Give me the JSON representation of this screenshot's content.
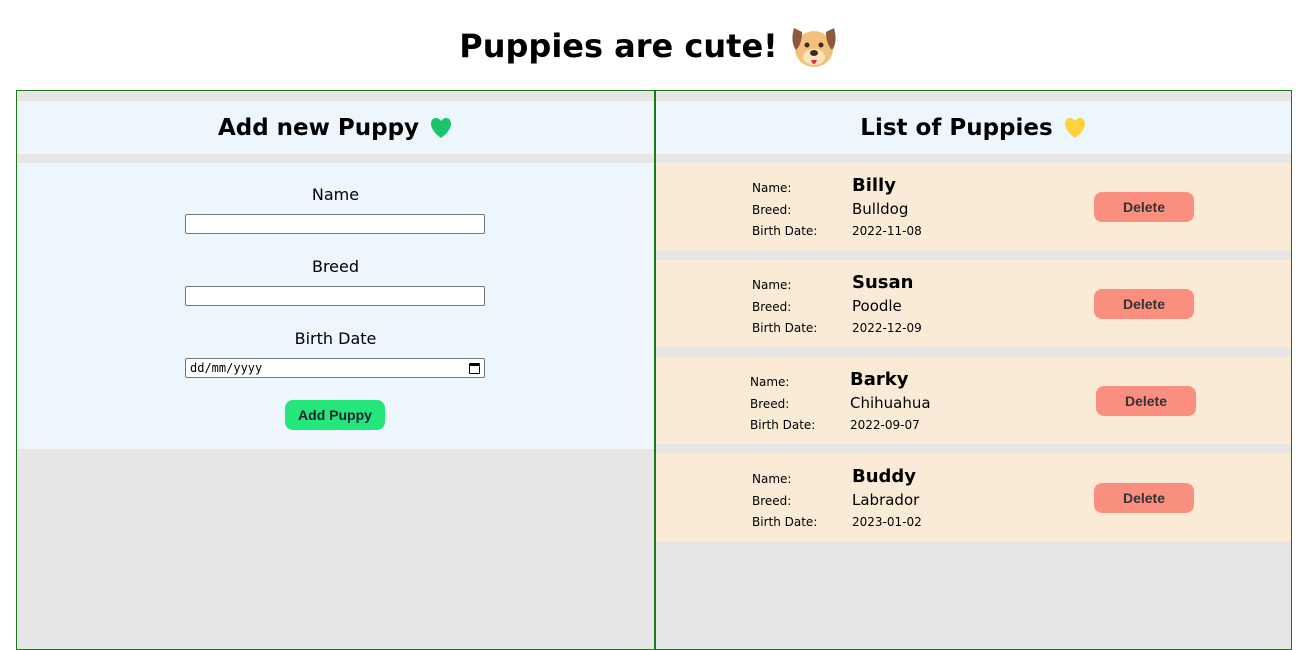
{
  "page_title": "Puppies are cute!",
  "form": {
    "heading": "Add new Puppy",
    "name_label": "Name",
    "name_value": "",
    "breed_label": "Breed",
    "breed_value": "",
    "birth_date_label": "Birth Date",
    "birth_date_placeholder": "dd/mm/yyyy",
    "submit_label": "Add Puppy"
  },
  "list": {
    "heading": "List of Puppies",
    "name_key": "Name:",
    "breed_key": "Breed:",
    "birth_key": "Birth Date:",
    "delete_label": "Delete",
    "puppies": [
      {
        "name": "Billy",
        "breed": "Bulldog",
        "birth_date": "2022-11-08"
      },
      {
        "name": "Susan",
        "breed": "Poodle",
        "birth_date": "2022-12-09"
      },
      {
        "name": "Barky",
        "breed": "Chihuahua",
        "birth_date": "2022-09-07"
      },
      {
        "name": "Buddy",
        "breed": "Labrador",
        "birth_date": "2023-01-02"
      }
    ]
  },
  "colors": {
    "border": "#1a7a1a",
    "panel": "#eef6fd",
    "card": "#faebd7",
    "add_button": "#25e67a",
    "delete_button": "#fa8f80"
  },
  "icons": {
    "title": "dog-face-icon",
    "form_heading": "green-heart-icon",
    "list_heading": "yellow-heart-icon"
  }
}
